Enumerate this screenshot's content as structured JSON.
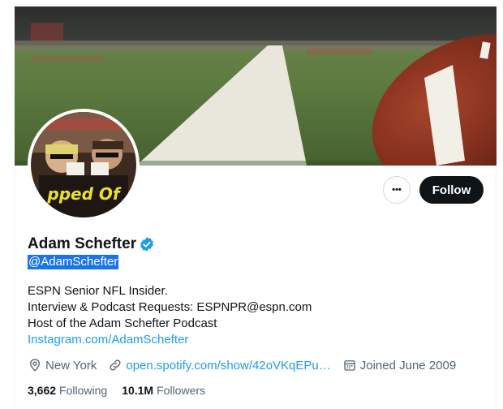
{
  "profile": {
    "display_name": "Adam Schefter",
    "handle": "@AdamSchefter",
    "verified": true,
    "avatar_text": "pped Of"
  },
  "actions": {
    "more_label": "•••",
    "follow_label": "Follow"
  },
  "bio": {
    "line1": "ESPN Senior NFL Insider.",
    "line2": "Interview & Podcast Requests: ESPNPR@espn.com",
    "line3": "Host of the Adam Schefter Podcast",
    "link": "Instagram.com/AdamSchefter"
  },
  "meta": {
    "location": "New York",
    "website": "open.spotify.com/show/42oVKqEPu…",
    "joined": "Joined June 2009",
    "location_icon": "location-pin-icon",
    "link_icon": "link-icon",
    "calendar_icon": "calendar-icon"
  },
  "stats": {
    "following_count": "3,662",
    "following_label": "Following",
    "followers_count": "10.1M",
    "followers_label": "Followers"
  },
  "colors": {
    "accent": "#1d9bf0",
    "primary_text": "#0f1419",
    "secondary_text": "#536471",
    "follow_button": "#0f1419",
    "selection": "#1a73e8"
  }
}
